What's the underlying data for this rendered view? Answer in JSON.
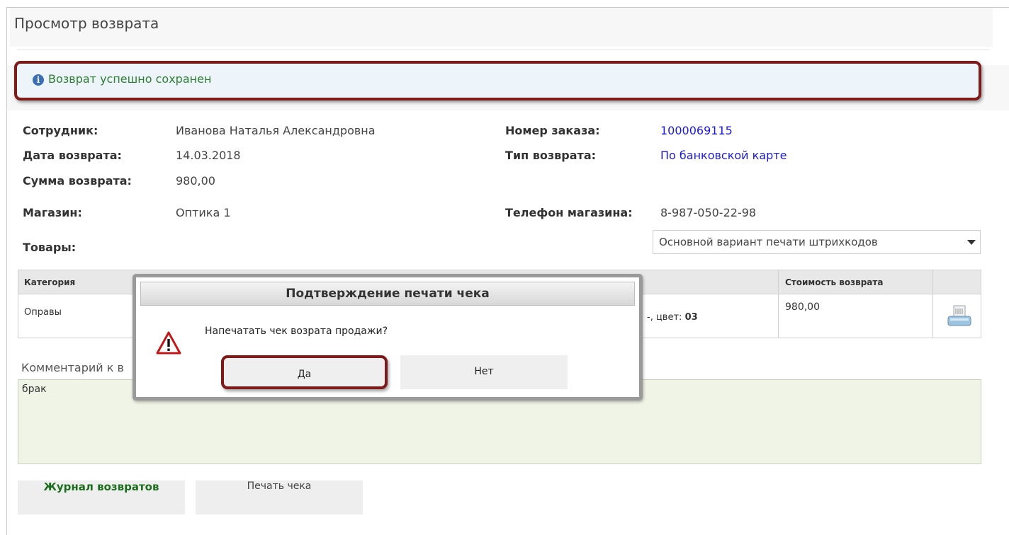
{
  "page": {
    "title": "Просмотр возврата"
  },
  "notice": {
    "text": "Возврат успешно сохранен"
  },
  "details": {
    "employee_label": "Сотрудник:",
    "employee_value": "Иванова Наталья Александровна",
    "date_label": "Дата возврата:",
    "date_value": "14.03.2018",
    "sum_label": "Сумма возврата:",
    "sum_value": "980,00",
    "store_label": "Магазин:",
    "store_value": "Оптика 1",
    "order_label": "Номер заказа:",
    "order_value": "1000069115",
    "type_label": "Тип возврата:",
    "type_value": "По банковской карте",
    "phone_label": "Телефон магазина:",
    "phone_value": "8-987-050-22-98",
    "goods_label": "Товары:"
  },
  "barcode_select": {
    "value": "Основной вариант печати штрихкодов"
  },
  "table": {
    "headers": [
      "Категория",
      "Стоимость возврата"
    ],
    "rows": [
      {
        "category": "Оправы",
        "desc_visible": "-, цвет: ",
        "desc_color": "03",
        "cost": "980,00"
      }
    ]
  },
  "comment": {
    "label_visible": "Комментарий к в",
    "value": "брак"
  },
  "buttons": {
    "journal": "Журнал возвратов",
    "print": "Печать чека"
  },
  "dialog": {
    "title": "Подтверждение печати чека",
    "message": "Напечатать чек возрата продажи?",
    "yes": "Да",
    "no": "Нет"
  },
  "colors": {
    "highlight": "#7d1a1a",
    "link": "#1a1ad6",
    "success": "#2e7d32",
    "comment_bg": "#eff4e6"
  },
  "icons": {
    "notice": "info-icon",
    "dialog": "warning-icon",
    "row_action": "printer-icon"
  }
}
